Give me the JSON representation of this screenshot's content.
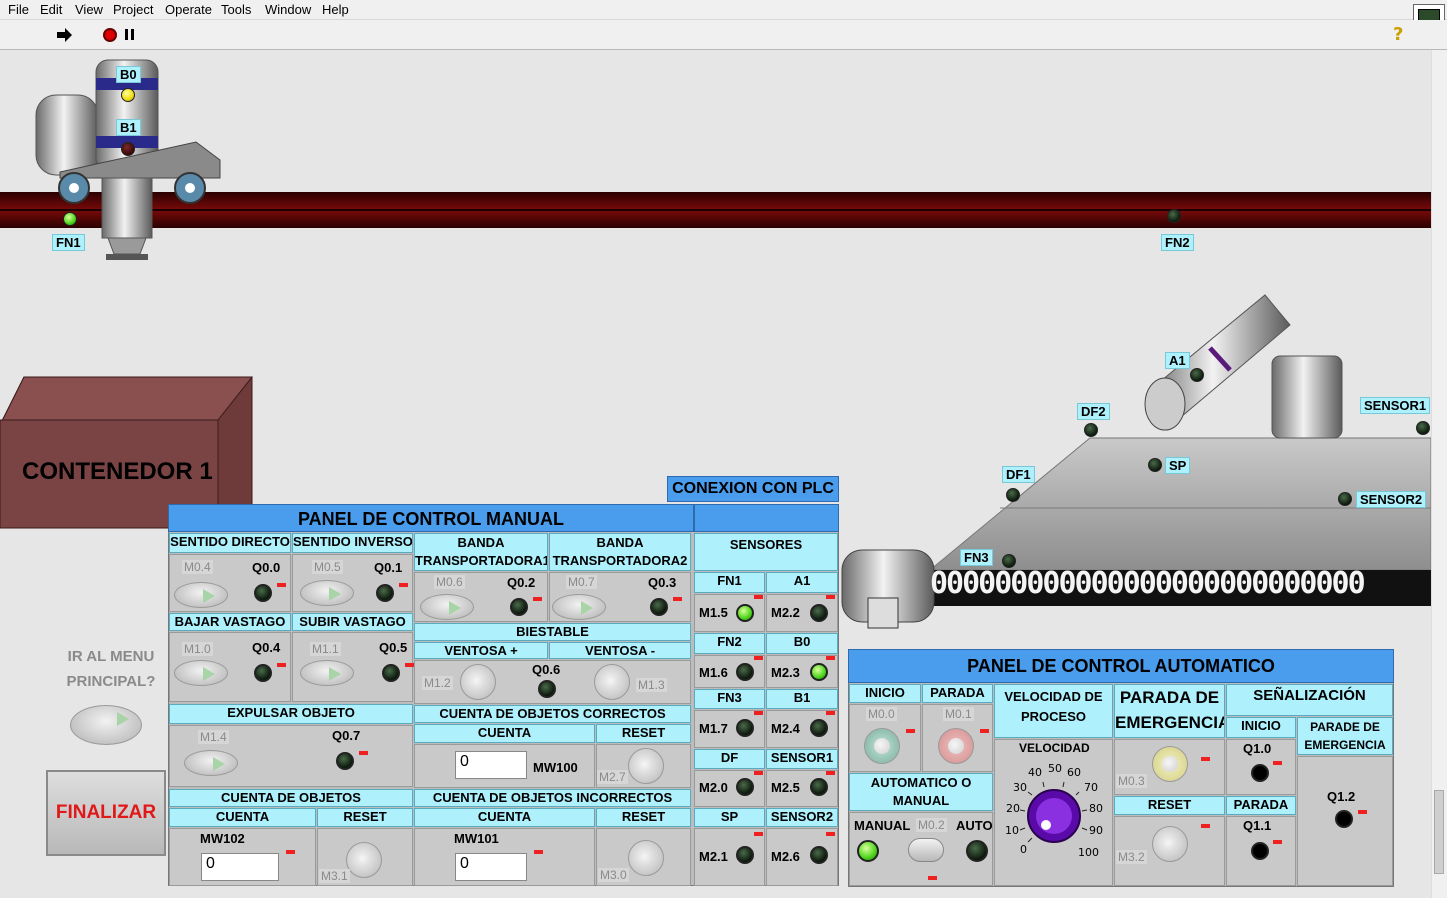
{
  "menu": [
    "File",
    "Edit",
    "View",
    "Project",
    "Operate",
    "Tools",
    "Window",
    "Help"
  ],
  "toolbar": {
    "help": "?"
  },
  "plant": {
    "hopper_labels": {
      "b0": "B0",
      "b1": "B1",
      "fn1": "FN1",
      "fn2": "FN2"
    },
    "conveyor_labels": {
      "a1": "A1",
      "df2": "DF2",
      "df1": "DF1",
      "sp": "SP",
      "sensor1": "SENSOR1",
      "sensor2": "SENSOR2",
      "fn3": "FN3"
    },
    "container": "CONTENEDOR 1",
    "belt_links": "000000000000000000000000000"
  },
  "nav": {
    "menu_label": "IR AL MENU\nPRINCIPAL?",
    "finalize": "FINALIZAR"
  },
  "plc": {
    "title": "CONEXION CON PLC"
  },
  "manual": {
    "title": "PANEL DE CONTROL MANUAL",
    "sentido_directo": "SENTIDO DIRECTO",
    "sentido_inverso": "SENTIDO INVERSO",
    "banda1": "BANDA\nTRANSPORTADORA1",
    "banda2": "BANDA\nTRANSPORTADORA2",
    "m04": "M0.4",
    "q00": "Q0.0",
    "m05": "M0.5",
    "q01": "Q0.1",
    "m06": "M0.6",
    "q02": "Q0.2",
    "m07": "M0.7",
    "q03": "Q0.3",
    "bajar": "BAJAR VASTAGO",
    "subir": "SUBIR VASTAGO",
    "biestable": "BIESTABLE",
    "ventosa_plus": "VENTOSA +",
    "ventosa_minus": "VENTOSA -",
    "m10": "M1.0",
    "q04": "Q0.4",
    "m11": "M1.1",
    "q05": "Q0.5",
    "m12": "M1.2",
    "q06": "Q0.6",
    "m13": "M1.3",
    "expulsar": "EXPULSAR OBJETO",
    "m14": "M1.4",
    "q07": "Q0.7",
    "cuenta_correctos": "CUENTA DE OBJETOS CORRECTOS",
    "cuenta": "CUENTA",
    "reset": "RESET",
    "mw100": "MW100",
    "mw100_value": "0",
    "m27": "M2.7",
    "cuenta_objetos": "CUENTA DE OBJETOS",
    "mw102": "MW102",
    "mw102_value": "0",
    "m31": "M3.1",
    "cuenta_incorrectos": "CUENTA DE OBJETOS INCORRECTOS",
    "mw101": "MW101",
    "mw101_value": "0",
    "m30": "M3.0"
  },
  "sensores": {
    "title": "SENSORES",
    "rows": [
      {
        "l": "FN1",
        "r": "A1",
        "ml": "M1.5",
        "mr": "M2.2"
      },
      {
        "l": "FN2",
        "r": "B0",
        "ml": "M1.6",
        "mr": "M2.3"
      },
      {
        "l": "FN3",
        "r": "B1",
        "ml": "M1.7",
        "mr": "M2.4"
      },
      {
        "l": "DF",
        "r": "SENSOR1",
        "ml": "M2.0",
        "mr": "M2.5"
      },
      {
        "l": "SP",
        "r": "SENSOR2",
        "ml": "M2.1",
        "mr": "M2.6"
      }
    ]
  },
  "auto": {
    "title": "PANEL DE CONTROL AUTOMATICO",
    "inicio": "INICIO",
    "parada": "PARADA",
    "m00": "M0.0",
    "m01": "M0.1",
    "automatico": "AUTOMATICO O\nMANUAL",
    "manual": "MANUAL",
    "m02": "M0.2",
    "auto": "AUTO",
    "velocidad_title": "VELOCIDAD DE\nPROCESO",
    "velocidad": "VELOCIDAD",
    "dial_ticks": [
      "0",
      "10",
      "20",
      "30",
      "40",
      "50",
      "60",
      "70",
      "80",
      "90",
      "100"
    ],
    "parada_emergencia": "PARADA DE\nEMERGENCIA",
    "m03": "M0.3",
    "reset": "RESET",
    "m32": "M3.2",
    "senalizacion": "SEÑALIZACIÓN",
    "sen_inicio": "INICIO",
    "sen_parade": "PARADE DE\nEMERGENCIA",
    "q10": "Q1.0",
    "sen_parada": "PARADA",
    "q11": "Q1.1",
    "q12": "Q1.2"
  }
}
